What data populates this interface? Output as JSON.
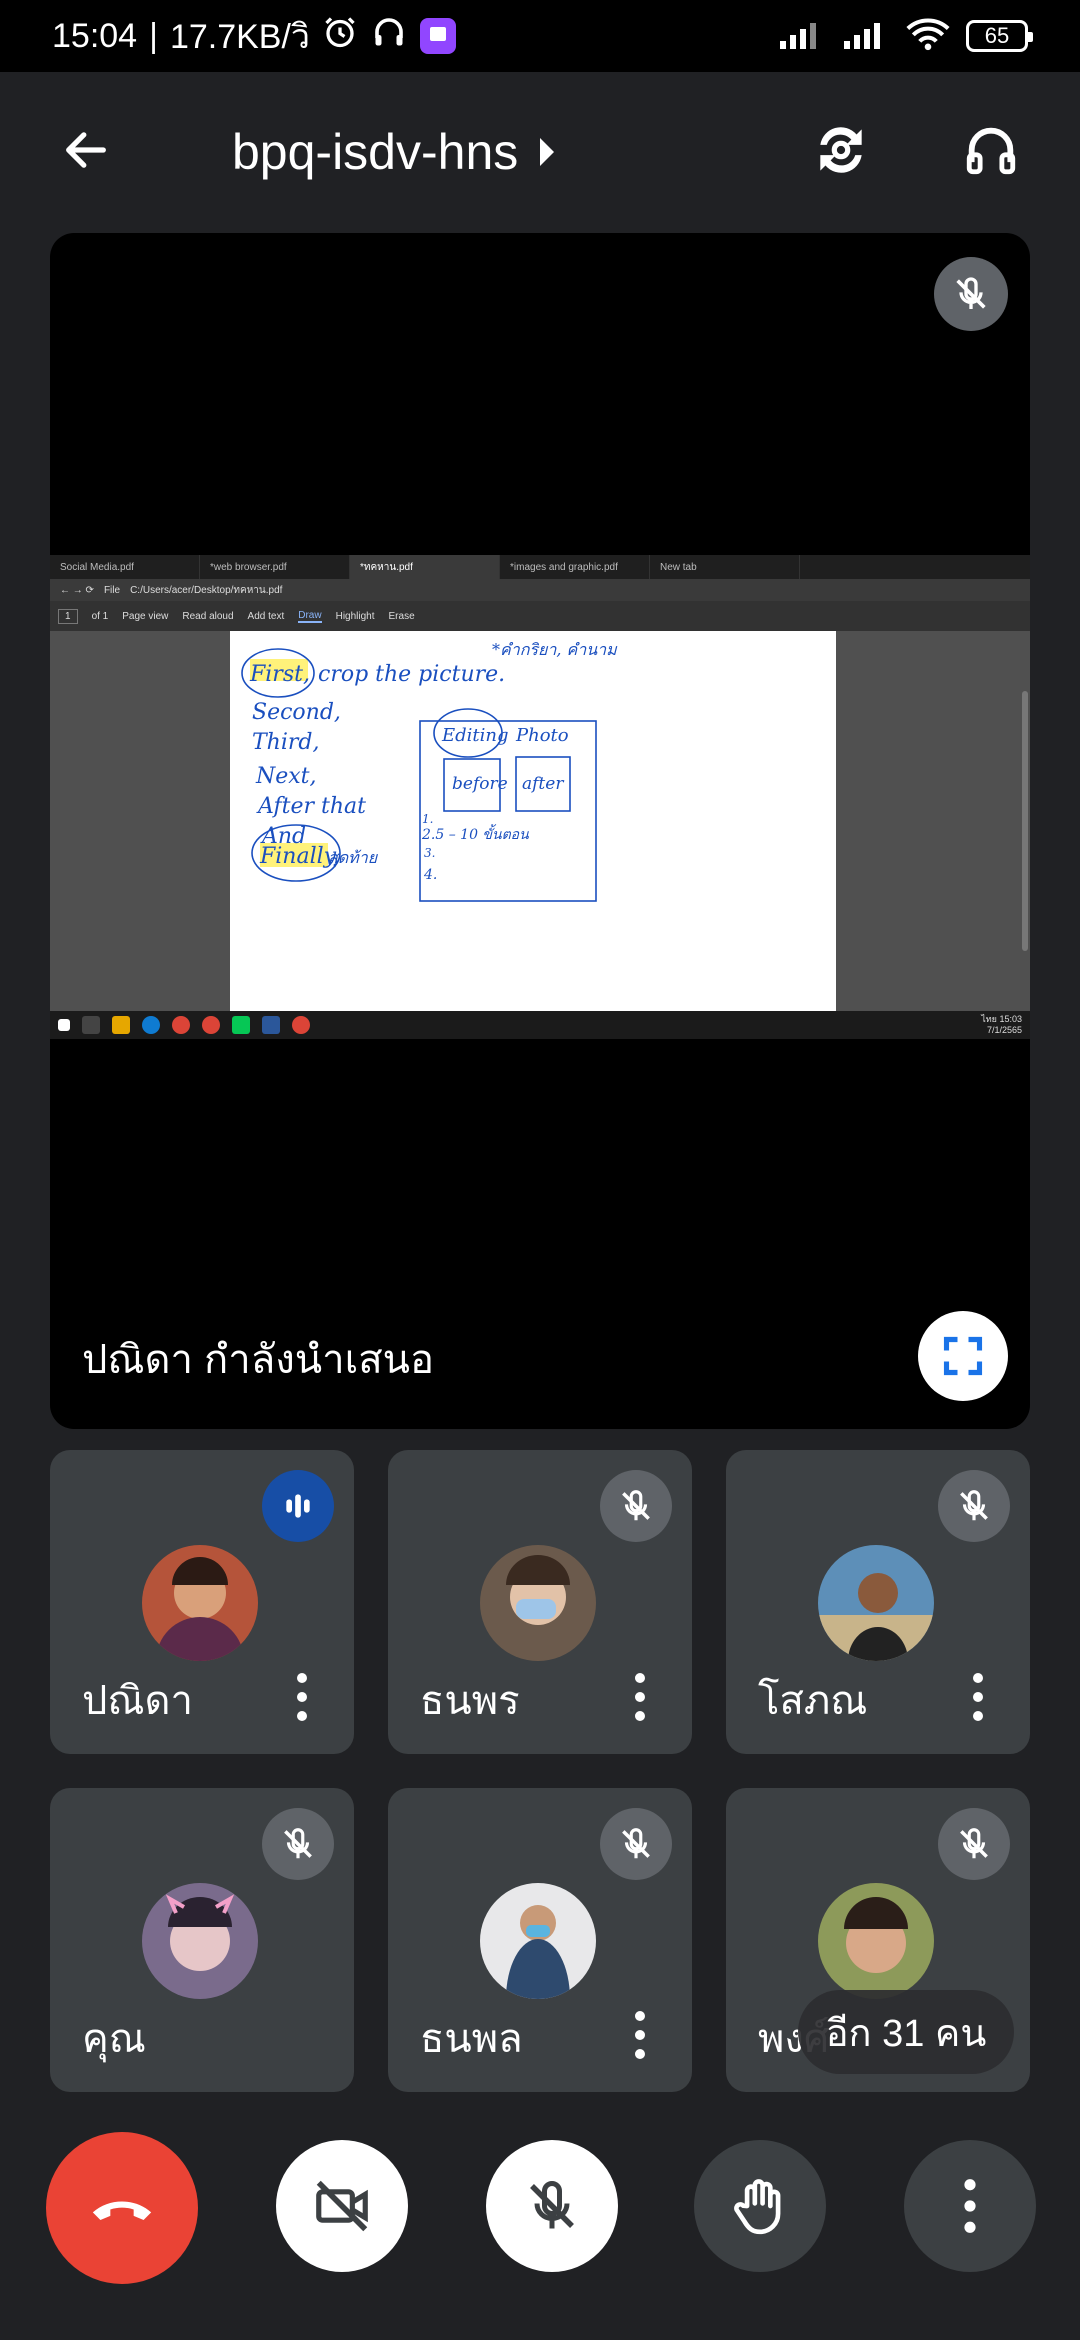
{
  "status_bar": {
    "time": "15:04",
    "speed": "17.7KB/วิ",
    "battery": "65"
  },
  "header": {
    "meeting_code": "bpq-isdv-hns"
  },
  "stage": {
    "presenter_label": "ปณิดา กำลังนำเสนอ"
  },
  "screen_share": {
    "tabs": [
      "Social Media.pdf",
      "*web browser.pdf",
      "*ทคหาน.pdf",
      "*images and graphic.pdf",
      "New tab"
    ],
    "address_file": "File",
    "address_path": "C:/Users/acer/Desktop/ทคหาน.pdf",
    "page_number": "1",
    "page_of": "of 1",
    "toolbar": [
      "Page view",
      "Read aloud",
      "Add text",
      "Draw",
      "Highlight",
      "Erase"
    ],
    "notes": {
      "line1a": "First,",
      "line1b": "crop the picture.",
      "topright": "*คำกริยา, คำนาม",
      "line2": "Second,",
      "line3": "Third,",
      "line4": "Next,",
      "line5": "After that",
      "line6": "And",
      "line7a": "Finally,",
      "line7b": "สุดท้าย",
      "box_title_a": "Editing",
      "box_title_b": "Photo",
      "before": "before",
      "after": "after",
      "list1": "1.",
      "list2": "2.5 – 10 ขั้นตอน",
      "list3": "3.",
      "list4": "4."
    },
    "taskbar_time": "15:03",
    "taskbar_date": "7/1/2565",
    "taskbar_lang": "ไทย"
  },
  "participants": [
    {
      "name": "ปณิดา",
      "status": "speaking",
      "avatar": "#b5543a"
    },
    {
      "name": "ธนพร",
      "status": "muted",
      "avatar": "#6b5a4c"
    },
    {
      "name": "โสภณ",
      "status": "muted",
      "avatar": "#5d8fb8"
    },
    {
      "name": "คุณ",
      "status": "muted",
      "avatar": "#7a6b8c"
    },
    {
      "name": "ธนพล",
      "status": "muted",
      "avatar": "#2e4a6e"
    },
    {
      "name": "พงศ์",
      "status": "muted",
      "avatar": "#8d9a5a"
    }
  ],
  "others_pill": "อีก 31 คน",
  "colors": {
    "background": "#202124",
    "tile": "#3c4043",
    "hangup": "#ea4335",
    "speaking": "#174ea6",
    "pen": "#1a4fbf",
    "highlight": "#fff27a"
  }
}
